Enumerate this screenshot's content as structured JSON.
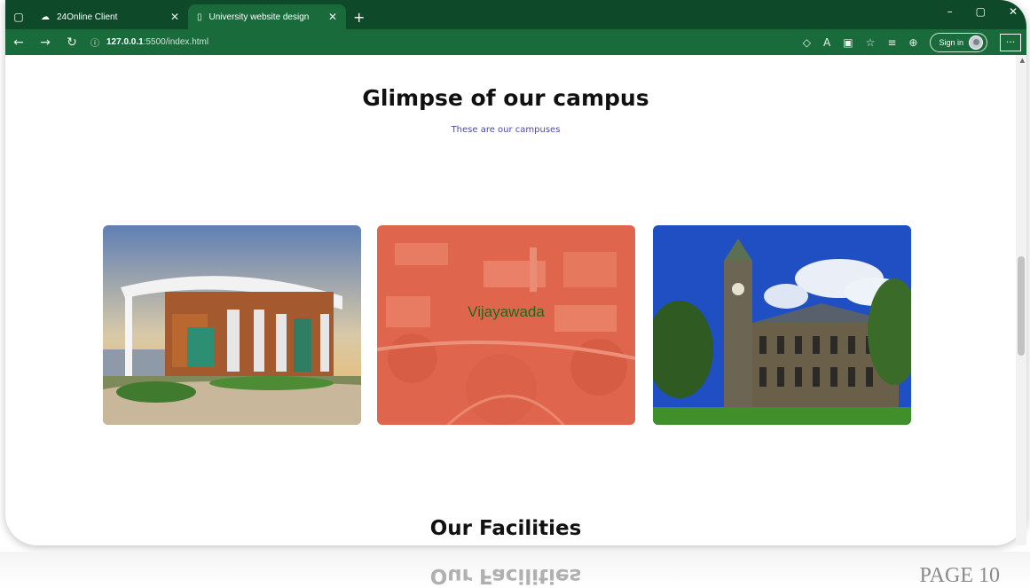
{
  "browser": {
    "tabs": [
      {
        "title": "24Online Client",
        "active": false
      },
      {
        "title": "University website design",
        "active": true
      }
    ],
    "url_host": "127.0.0.1",
    "url_path": ":5500/index.html",
    "sign_in_label": "Sign in"
  },
  "page": {
    "campus_heading": "Glimpse of our campus",
    "campus_subheading": "These are our campuses",
    "campuses": [
      {
        "label": ""
      },
      {
        "label": "Vijayawada"
      },
      {
        "label": ""
      }
    ],
    "facilities_heading": "Our Facilities",
    "facilities_reflection": "Our Facilities",
    "page_number": "PAGE 10"
  },
  "colors": {
    "tabbar": "#0e4a2a",
    "toolbar": "#1a6b3c",
    "subheading": "#4b4ba3",
    "overlay": "#e8614a"
  }
}
